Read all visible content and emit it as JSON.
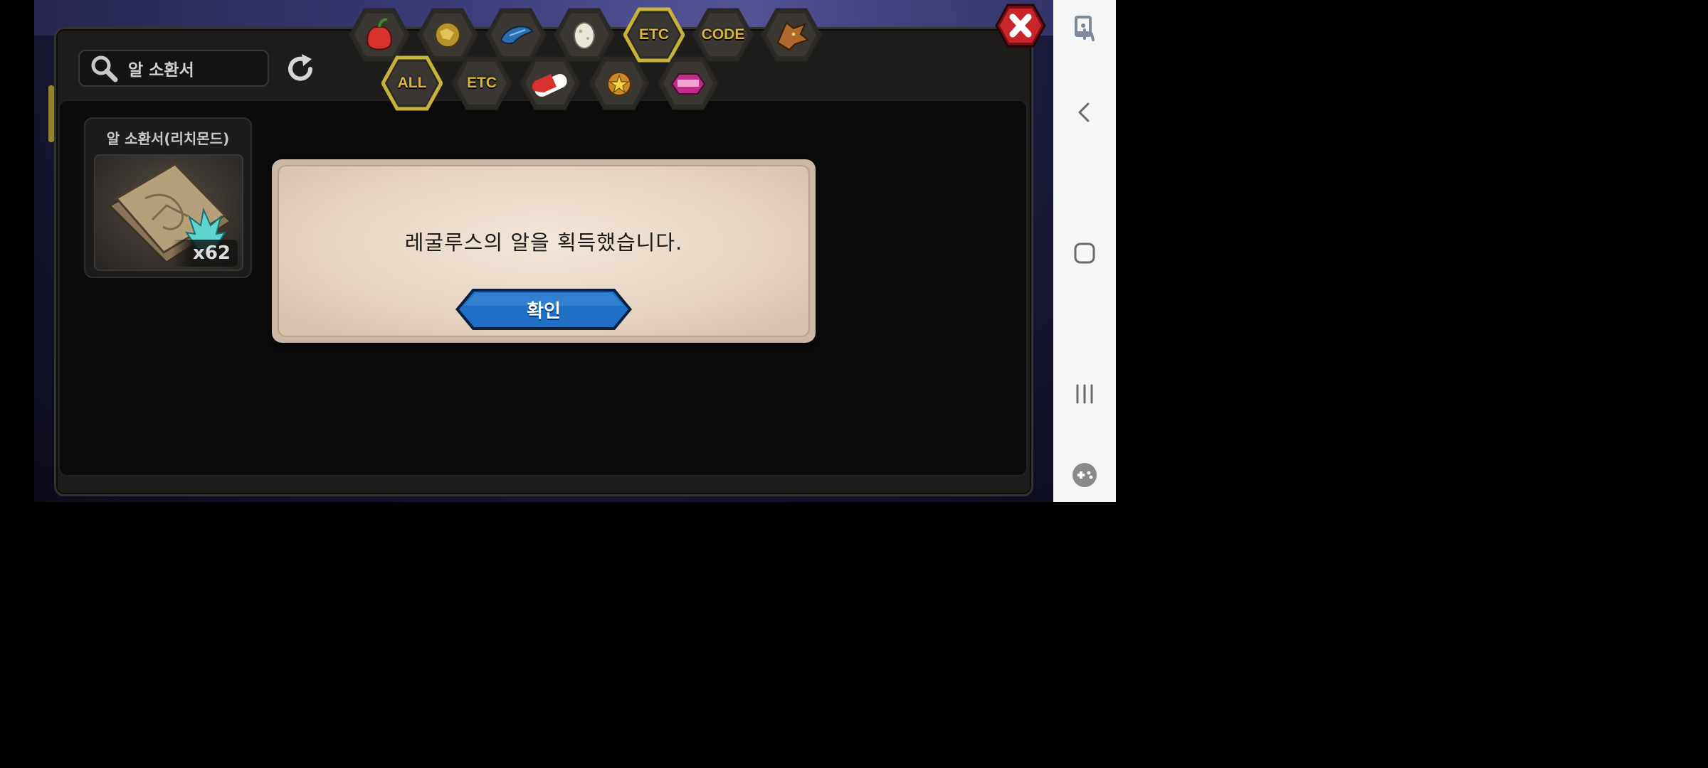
{
  "search": {
    "query": "알 소환서"
  },
  "category_tabs_top": [
    {
      "name": "fruit",
      "icon": "fruit-icon"
    },
    {
      "name": "ore",
      "icon": "gold-ore-icon"
    },
    {
      "name": "scale",
      "icon": "blue-scale-icon"
    },
    {
      "name": "egg",
      "icon": "egg-icon"
    },
    {
      "name": "etc",
      "label": "ETC",
      "selected": true
    },
    {
      "name": "code",
      "label": "CODE"
    },
    {
      "name": "dragon",
      "icon": "dragon-head-icon"
    }
  ],
  "category_tabs_bottom": [
    {
      "name": "all",
      "label": "ALL",
      "selected": true
    },
    {
      "name": "etc",
      "label": "ETC"
    },
    {
      "name": "capsule",
      "icon": "capsule-icon"
    },
    {
      "name": "medal",
      "icon": "star-medal-icon"
    },
    {
      "name": "gift",
      "icon": "gift-box-icon"
    }
  ],
  "item": {
    "name": "알 소환서(리치몬드)",
    "count": "x62",
    "icon": "summon-scroll-icon"
  },
  "dialog": {
    "message": "레굴루스의 알을 획득했습니다.",
    "confirm_label": "확인"
  },
  "nav": [
    "touch-lock-icon",
    "back-icon",
    "home-icon",
    "recents-icon",
    "game-tools-icon"
  ],
  "colors": {
    "accent_gold": "#d9b53a",
    "confirm_blue": "#1f6fc4",
    "close_red": "#c8262c",
    "dialog_bg": "#e6d4c1"
  }
}
